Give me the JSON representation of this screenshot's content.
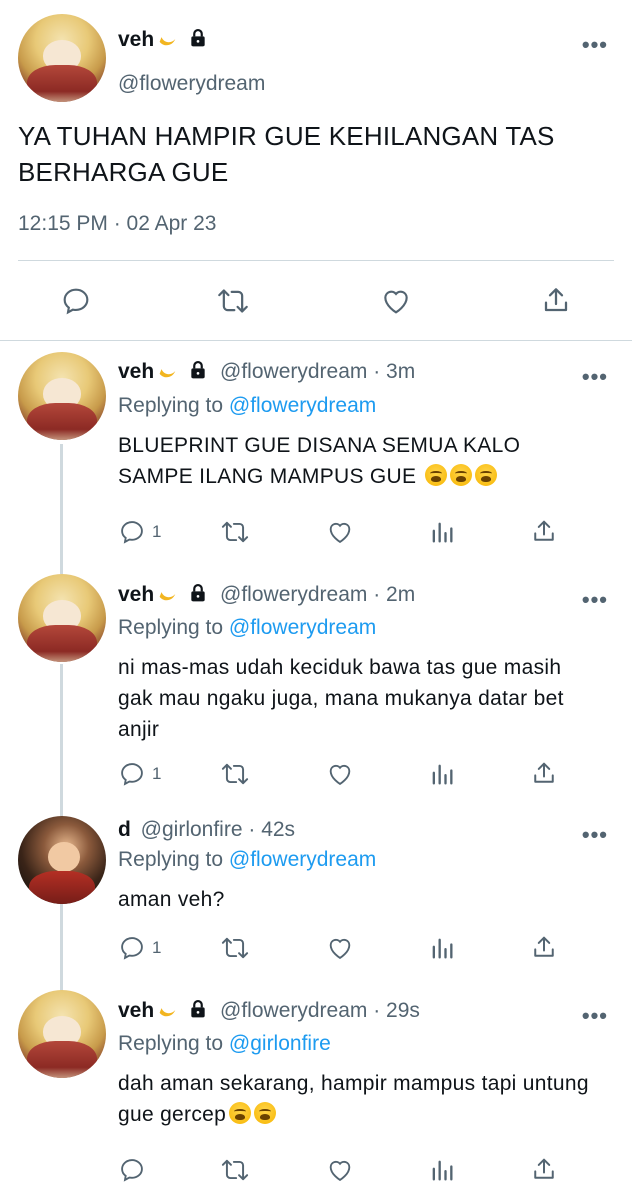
{
  "main_tweet": {
    "name": "veh",
    "handle": "@flowerydream",
    "text": "YA TUHAN HAMPIR GUE KEHILANGAN TAS BERHARGA GUE",
    "timestamp": "12:15 PM · 02 Apr 23",
    "more": "•••"
  },
  "replies": [
    {
      "name": "veh",
      "handle": "@flowerydream",
      "time": "· 3m",
      "replying_label": "Replying to",
      "replying_to": "@flowerydream",
      "text": "BLUEPRINT GUE DISANA SEMUA KALO SAMPE ILANG MAMPUS GUE",
      "reply_count": "1",
      "emoji_count": 3
    },
    {
      "name": "veh",
      "handle": "@flowerydream",
      "time": "· 2m",
      "replying_label": "Replying to",
      "replying_to": "@flowerydream",
      "text": "ni mas-mas udah keciduk bawa tas gue masih gak mau ngaku juga, mana mukanya datar bet anjir",
      "reply_count": "1"
    },
    {
      "name": "d",
      "handle": "@girlonfire",
      "time": "· 42s",
      "replying_label": "Replying to",
      "replying_to": "@flowerydream",
      "text": "aman veh?",
      "reply_count": "1"
    },
    {
      "name": "veh",
      "handle": "@flowerydream",
      "time": "· 29s",
      "replying_label": "Replying to",
      "replying_to": "@girlonfire",
      "text": "dah aman sekarang, hampir mampus tapi untung gue gercep",
      "reply_count": ""
    }
  ],
  "icons": {
    "reply": "reply-icon",
    "retweet": "retweet-icon",
    "like": "heart-icon",
    "views": "views-icon",
    "share": "share-icon",
    "lock": "lock-icon",
    "more": "more-icon"
  },
  "colors": {
    "accent": "#1d9bf0",
    "muted": "#536471",
    "divider": "#cfd9de"
  }
}
